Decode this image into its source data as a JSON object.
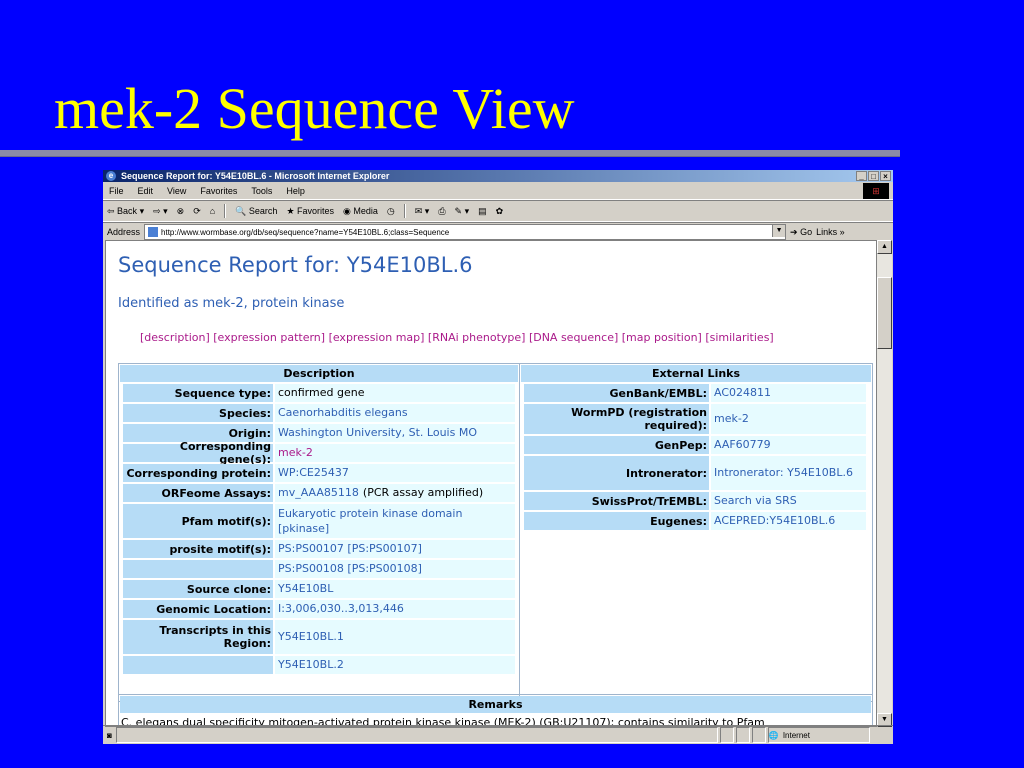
{
  "slide": {
    "title": "mek-2 Sequence View"
  },
  "browser": {
    "title": "Sequence Report for: Y54E10BL.6 - Microsoft Internet Explorer",
    "menu": [
      "File",
      "Edit",
      "View",
      "Favorites",
      "Tools",
      "Help"
    ],
    "toolbar": {
      "back": "Back",
      "search": "Search",
      "favorites": "Favorites",
      "media": "Media"
    },
    "address_label": "Address",
    "address_url": "http://www.wormbase.org/db/seq/sequence?name=Y54E10BL.6;class=Sequence",
    "go_label": "Go",
    "links_label": "Links",
    "status_zone": "Internet"
  },
  "page": {
    "title": "Sequence Report for: Y54E10BL.6",
    "subtitle": "Identified as mek-2, protein kinase",
    "nav_links": "[description] [expression pattern] [expression map] [RNAi phenotype] [DNA sequence] [map position] [similarities]",
    "description_header": "Description",
    "external_header": "External Links",
    "description": [
      {
        "label": "Sequence type:",
        "value": "confirmed gene"
      },
      {
        "label": "Species:",
        "value": "Caenorhabditis elegans"
      },
      {
        "label": "Origin:",
        "value": "Washington University, St. Louis MO"
      },
      {
        "label": "Corresponding gene(s):",
        "value": "mek-2"
      },
      {
        "label": "Corresponding protein:",
        "value": "WP:CE25437"
      },
      {
        "label": "ORFeome Assays:",
        "value": "mv_AAA85118",
        "extra": "(PCR assay amplified)"
      },
      {
        "label": "Pfam motif(s):",
        "value": "Eukaryotic protein kinase domain [pkinase]"
      },
      {
        "label": "prosite motif(s):",
        "value": "PS:PS00107 [PS:PS00107]"
      },
      {
        "label": "",
        "value": "PS:PS00108 [PS:PS00108]"
      },
      {
        "label": "Source clone:",
        "value": "Y54E10BL"
      },
      {
        "label": "Genomic Location:",
        "value": "I:3,006,030..3,013,446"
      },
      {
        "label": "Transcripts in this Region:",
        "value": "Y54E10BL.1"
      },
      {
        "label": "",
        "value": "Y54E10BL.2"
      }
    ],
    "external_links": [
      {
        "label": "GenBank/EMBL:",
        "value": "AC024811"
      },
      {
        "label": "WormPD (registration required):",
        "value": "mek-2"
      },
      {
        "label": "GenPep:",
        "value": "AAF60779"
      },
      {
        "label": "Intronerator:",
        "value": "Intronerator: Y54E10BL.6"
      },
      {
        "label": "SwissProt/TrEMBL:",
        "value": "Search via SRS"
      },
      {
        "label": "Eugenes:",
        "value": "ACEPRED:Y54E10BL.6"
      }
    ],
    "remarks_header": "Remarks",
    "remarks_text": "C. elegans dual specificity mitogen-activated protein kinase kinase (MEK-2) (GB:U21107); contains similarity to Pfam"
  }
}
